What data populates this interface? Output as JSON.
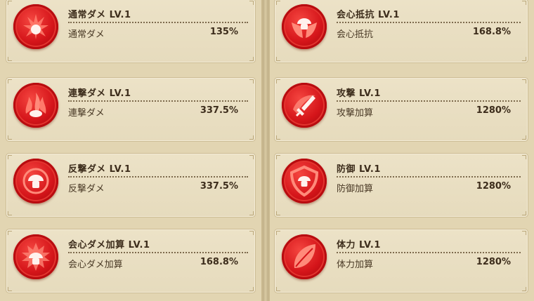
{
  "left_column": [
    {
      "title": "通常ダメ LV.1",
      "label": "通常ダメ",
      "value": "135%",
      "icon": "flame-burst-icon"
    },
    {
      "title": "連撃ダメ LV.1",
      "label": "連撃ダメ",
      "value": "337.5%",
      "icon": "triple-flame-icon"
    },
    {
      "title": "反撃ダメ LV.1",
      "label": "反撃ダメ",
      "value": "337.5%",
      "icon": "mushroom-shield-icon"
    },
    {
      "title": "会心ダメ加算 LV.1",
      "label": "会心ダメ加算",
      "value": "168.8%",
      "icon": "mushroom-burst-icon"
    }
  ],
  "right_column": [
    {
      "title": "会心抵抗 LV.1",
      "label": "会心抵抗",
      "value": "168.8%",
      "icon": "mushroom-wings-icon"
    },
    {
      "title": "攻撃 LV.1",
      "label": "攻撃加算",
      "value": "1280%",
      "icon": "sword-icon"
    },
    {
      "title": "防御 LV.1",
      "label": "防御加算",
      "value": "1280%",
      "icon": "shield-mushroom-icon"
    },
    {
      "title": "体力 LV.1",
      "label": "体力加算",
      "value": "1280%",
      "icon": "leaf-icon"
    }
  ],
  "colors": {
    "icon_red": "#d5151a",
    "card_bg": "#ece2c7",
    "text": "#3d2d1c"
  }
}
